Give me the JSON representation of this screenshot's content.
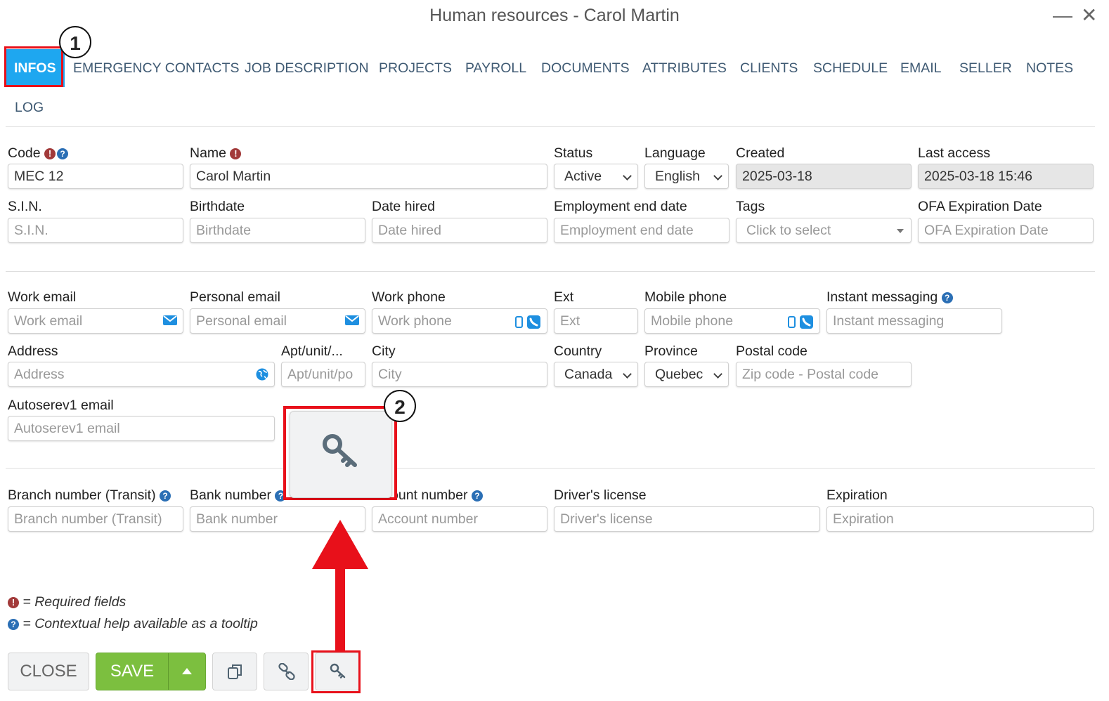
{
  "window": {
    "title": "Human resources - Carol Martin",
    "minimize_label": "—",
    "close_label": "✕"
  },
  "tabs": [
    {
      "label": "INFOS"
    },
    {
      "label": "EMERGENCY CONTACTS"
    },
    {
      "label": "JOB DESCRIPTION"
    },
    {
      "label": "PROJECTS"
    },
    {
      "label": "PAYROLL"
    },
    {
      "label": "DOCUMENTS"
    },
    {
      "label": "ATTRIBUTES"
    },
    {
      "label": "CLIENTS"
    },
    {
      "label": "SCHEDULE"
    },
    {
      "label": "EMAIL"
    },
    {
      "label": "SELLER"
    },
    {
      "label": "NOTES"
    },
    {
      "label": "LOG"
    }
  ],
  "fields": {
    "code": {
      "label": "Code",
      "value": "MEC 12"
    },
    "name": {
      "label": "Name",
      "value": "Carol Martin"
    },
    "status": {
      "label": "Status",
      "value": "Active"
    },
    "language": {
      "label": "Language",
      "value": "English"
    },
    "created": {
      "label": "Created",
      "value": "2025-03-18"
    },
    "last_access": {
      "label": "Last access",
      "value": "2025-03-18 15:46"
    },
    "sin": {
      "label": "S.I.N.",
      "placeholder": "S.I.N."
    },
    "birthdate": {
      "label": "Birthdate",
      "placeholder": "Birthdate"
    },
    "date_hired": {
      "label": "Date hired",
      "placeholder": "Date hired"
    },
    "employment_end": {
      "label": "Employment end date",
      "placeholder": "Employment end date"
    },
    "tags": {
      "label": "Tags",
      "placeholder": "Click to select"
    },
    "ofa": {
      "label": "OFA Expiration Date",
      "placeholder": "OFA Expiration Date"
    },
    "work_email": {
      "label": "Work email",
      "placeholder": "Work email"
    },
    "personal_email": {
      "label": "Personal email",
      "placeholder": "Personal email"
    },
    "work_phone": {
      "label": "Work phone",
      "placeholder": "Work phone"
    },
    "ext": {
      "label": "Ext",
      "placeholder": "Ext"
    },
    "mobile_phone": {
      "label": "Mobile phone",
      "placeholder": "Mobile phone"
    },
    "instant_messaging": {
      "label": "Instant messaging",
      "placeholder": "Instant messaging"
    },
    "address": {
      "label": "Address",
      "placeholder": "Address"
    },
    "apt": {
      "label": "Apt/unit/...",
      "placeholder": "Apt/unit/po"
    },
    "city": {
      "label": "City",
      "placeholder": "City"
    },
    "country": {
      "label": "Country",
      "value": "Canada"
    },
    "province": {
      "label": "Province",
      "value": "Quebec"
    },
    "postal_code": {
      "label": "Postal code",
      "placeholder": "Zip code - Postal code"
    },
    "autoserev_email": {
      "label": "Autoserev1 email",
      "placeholder": "Autoserev1 email"
    },
    "branch_number": {
      "label": "Branch number (Transit)",
      "placeholder": "Branch number (Transit)"
    },
    "bank_number": {
      "label": "Bank number",
      "placeholder": "Bank number"
    },
    "account_number": {
      "label": "ount number",
      "placeholder": "Account number"
    },
    "drivers_license": {
      "label": "Driver's license",
      "placeholder": "Driver's license"
    },
    "expiration": {
      "label": "Expiration",
      "placeholder": "Expiration"
    }
  },
  "legend": {
    "required": "= Required fields",
    "help": "= Contextual help available as a tooltip",
    "required_symbol": "!",
    "help_symbol": "?"
  },
  "buttons": {
    "close": "CLOSE",
    "save": "SAVE"
  },
  "annotations": {
    "step1": "1",
    "step2": "2"
  },
  "colors": {
    "active_tab": "#1ea7f0",
    "save": "#7cbf3f",
    "highlight": "#e8101a",
    "required": "#a23a3a",
    "help": "#2b6fb5"
  },
  "icons": [
    "email-icon",
    "mobile-icon",
    "phone-icon",
    "globe-icon",
    "key-icon",
    "copy-icon",
    "link-icon",
    "caret-up-icon"
  ]
}
